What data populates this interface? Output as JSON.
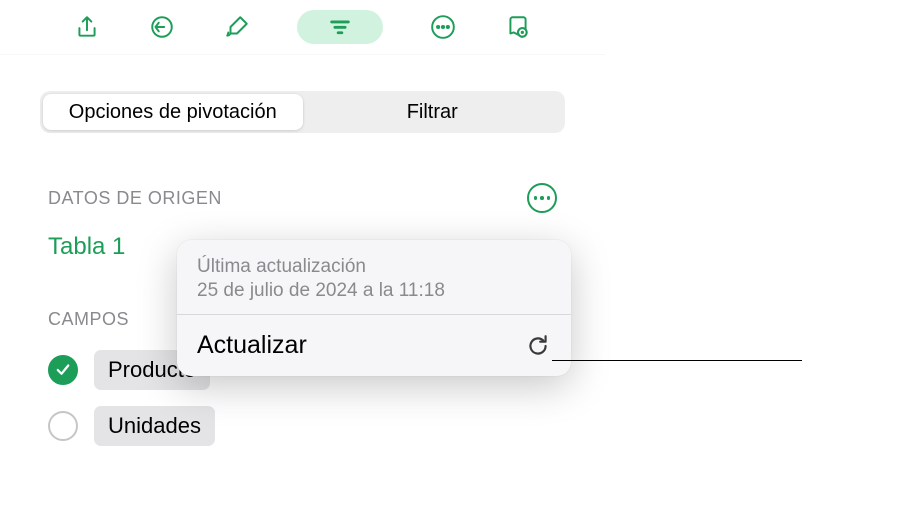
{
  "toolbar": {
    "icons": [
      "share-icon",
      "undo-icon",
      "brush-icon",
      "filter-icon",
      "more-icon",
      "activity-icon"
    ]
  },
  "tabs": {
    "pivot": "Opciones de pivotación",
    "filter": "Filtrar"
  },
  "source": {
    "header": "DATOS DE ORIGEN",
    "table": "Tabla 1"
  },
  "fields": {
    "header": "CAMPOS",
    "items": [
      {
        "label": "Producto",
        "checked": true
      },
      {
        "label": "Unidades",
        "checked": false
      }
    ]
  },
  "popover": {
    "last_update_label": "Última actualización",
    "last_update_value": "25 de julio de 2024 a la 11:18",
    "refresh": "Actualizar"
  }
}
